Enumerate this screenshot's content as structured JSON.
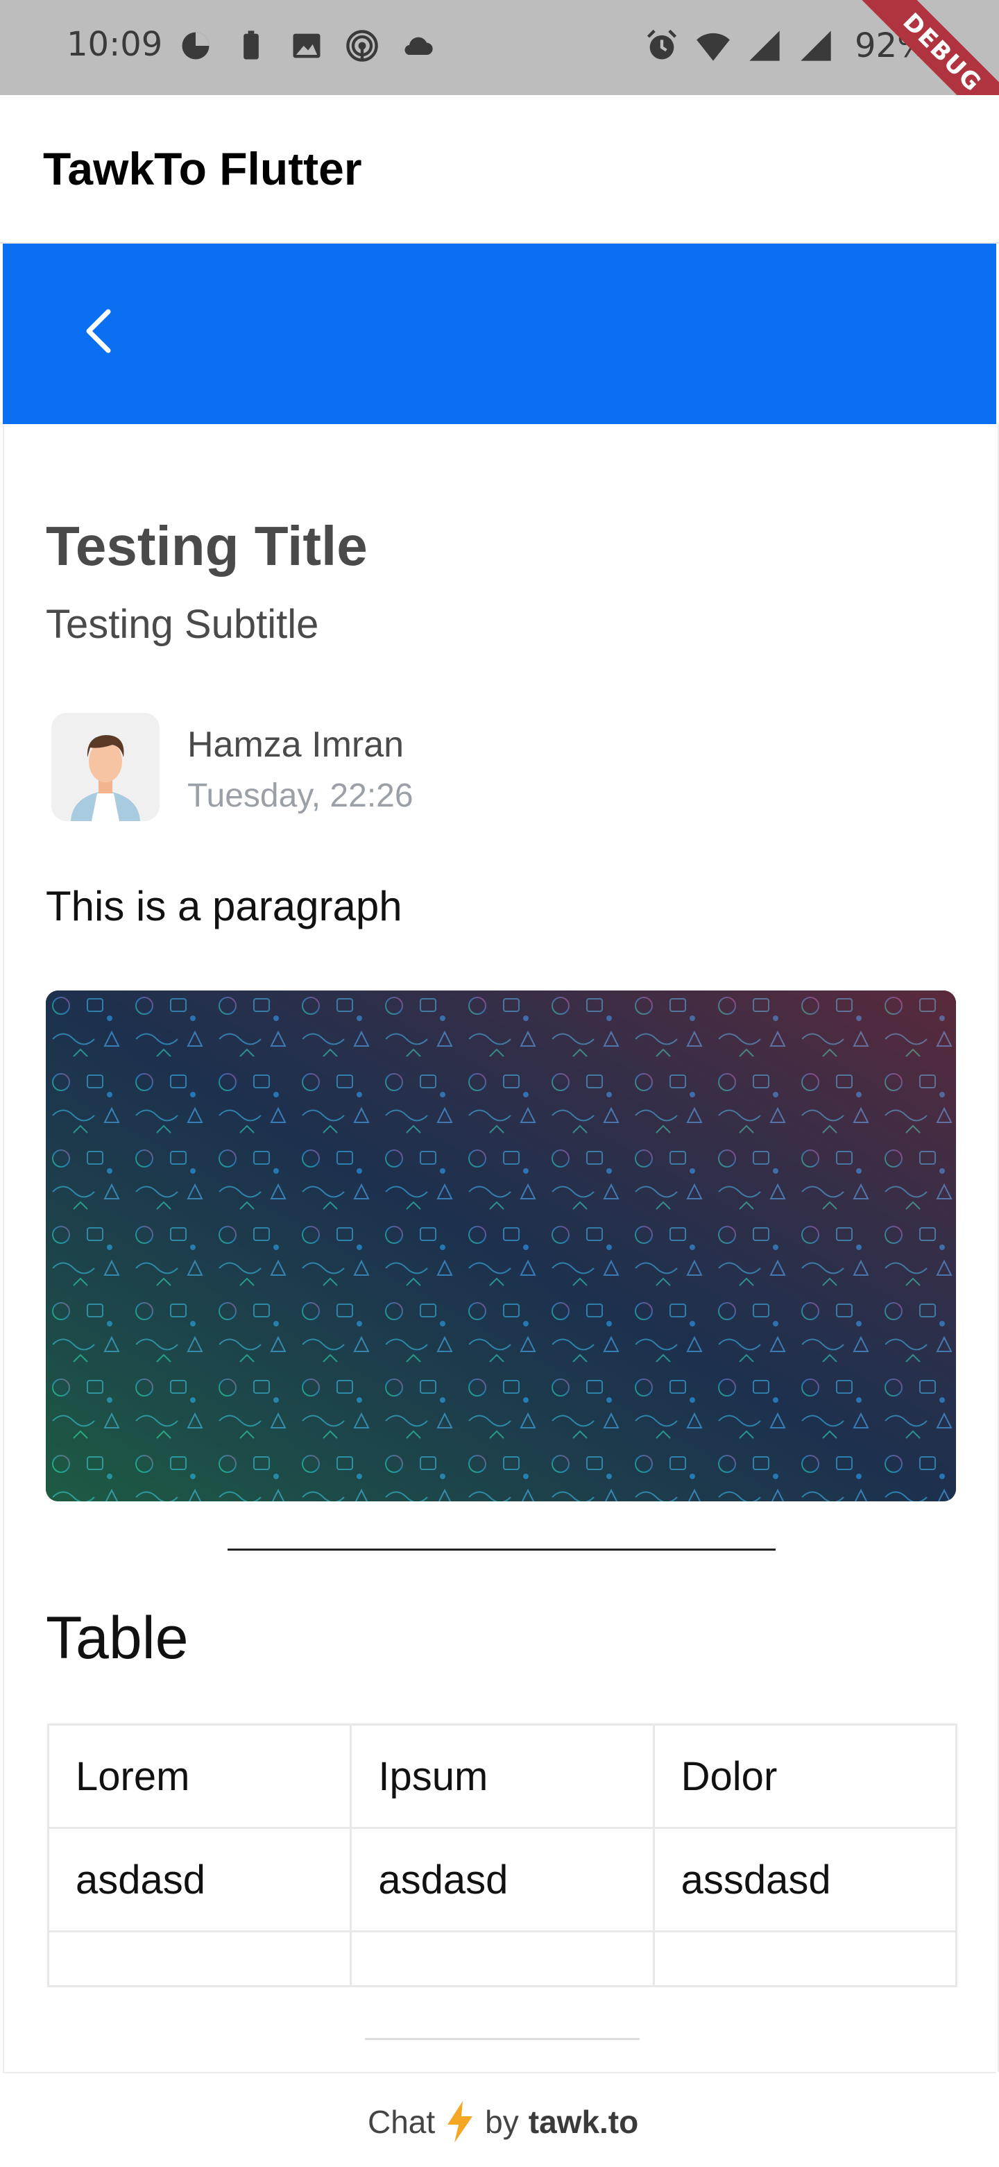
{
  "status_bar": {
    "time": "10:09",
    "battery": "92%",
    "left_icons": [
      "data-saver-icon",
      "battery-icon",
      "image-icon",
      "hotspot-icon",
      "cloud-icon"
    ],
    "right_icons": [
      "alarm-icon",
      "wifi-icon",
      "signal-icon",
      "signal-icon"
    ]
  },
  "debug_banner": "DEBUG",
  "app_bar": {
    "title": "TawkTo Flutter"
  },
  "header": {
    "back_icon": "chevron-left-icon",
    "color": "#0a6ff0"
  },
  "article": {
    "title": "Testing Title",
    "subtitle": "Testing Subtitle",
    "author": "Hamza Imran",
    "date": "Tuesday, 22:26",
    "paragraph": "This is a paragraph",
    "table_heading": "Table",
    "table": {
      "rows": [
        [
          "Lorem",
          "Ipsum",
          "Dolor"
        ],
        [
          "asdasd",
          "asdasd",
          "assdasd"
        ],
        [
          "",
          "",
          ""
        ]
      ]
    }
  },
  "footer": {
    "chat": "Chat",
    "by": "by",
    "brand": "tawk.to"
  }
}
